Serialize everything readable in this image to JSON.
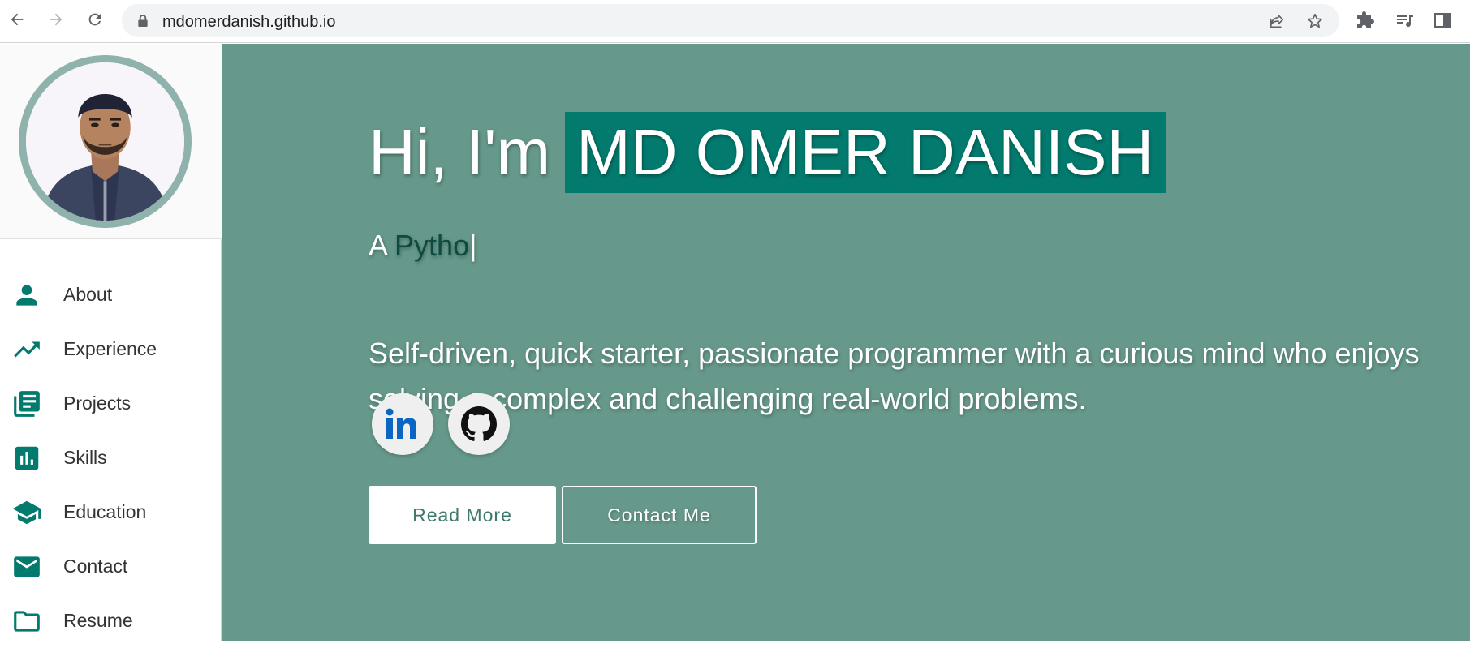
{
  "browser": {
    "url": "mdomerdanish.github.io",
    "icons": [
      "back-arrow-icon",
      "forward-arrow-icon",
      "reload-icon",
      "lock-icon",
      "share-icon",
      "star-icon",
      "extensions-icon",
      "media-icon",
      "side-panel-icon"
    ]
  },
  "sidebar": {
    "items": [
      {
        "label": "About",
        "icon": "person-icon"
      },
      {
        "label": "Experience",
        "icon": "trending-up-icon"
      },
      {
        "label": "Projects",
        "icon": "library-books-icon"
      },
      {
        "label": "Skills",
        "icon": "bar-chart-icon"
      },
      {
        "label": "Education",
        "icon": "graduation-cap-icon"
      },
      {
        "label": "Contact",
        "icon": "mail-icon"
      },
      {
        "label": "Resume",
        "icon": "folder-icon"
      }
    ]
  },
  "hero": {
    "greeting": "Hi, I'm",
    "name": "MD OMER DANISH",
    "tagline_prefix": "A",
    "tagline_typed": "Pytho",
    "tagline_cursor": "|",
    "summary": "Self-driven, quick starter, passionate programmer with a curious mind who enjoys solving a complex and challenging real-world problems.",
    "read_more": "Read More",
    "contact_me": "Contact Me",
    "social": [
      "linkedin-icon",
      "github-icon"
    ]
  },
  "colors": {
    "accent": "#037a6e",
    "hero_bg": "#66998b",
    "icon": "#037a6e"
  }
}
